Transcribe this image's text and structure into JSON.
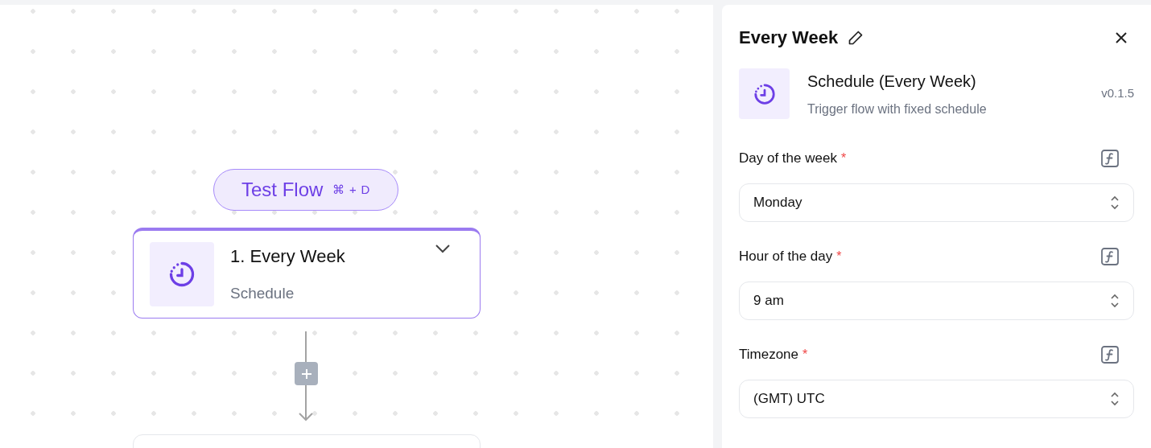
{
  "canvas": {
    "test_button": {
      "label": "Test Flow",
      "shortcut": "⌘ + D"
    },
    "step_card": {
      "title": "1. Every Week",
      "subtitle": "Schedule",
      "selected": true
    }
  },
  "panel": {
    "title": "Every Week",
    "step": {
      "name": "Schedule (Every Week)",
      "description": "Trigger flow with fixed schedule",
      "version": "v0.1.5"
    },
    "fields": [
      {
        "label": "Day of the week",
        "required_mark": "*",
        "value": "Monday"
      },
      {
        "label": "Hour of the day",
        "required_mark": "*",
        "value": "9 am"
      },
      {
        "label": "Timezone",
        "required_mark": "*",
        "value": "(GMT) UTC"
      }
    ]
  }
}
